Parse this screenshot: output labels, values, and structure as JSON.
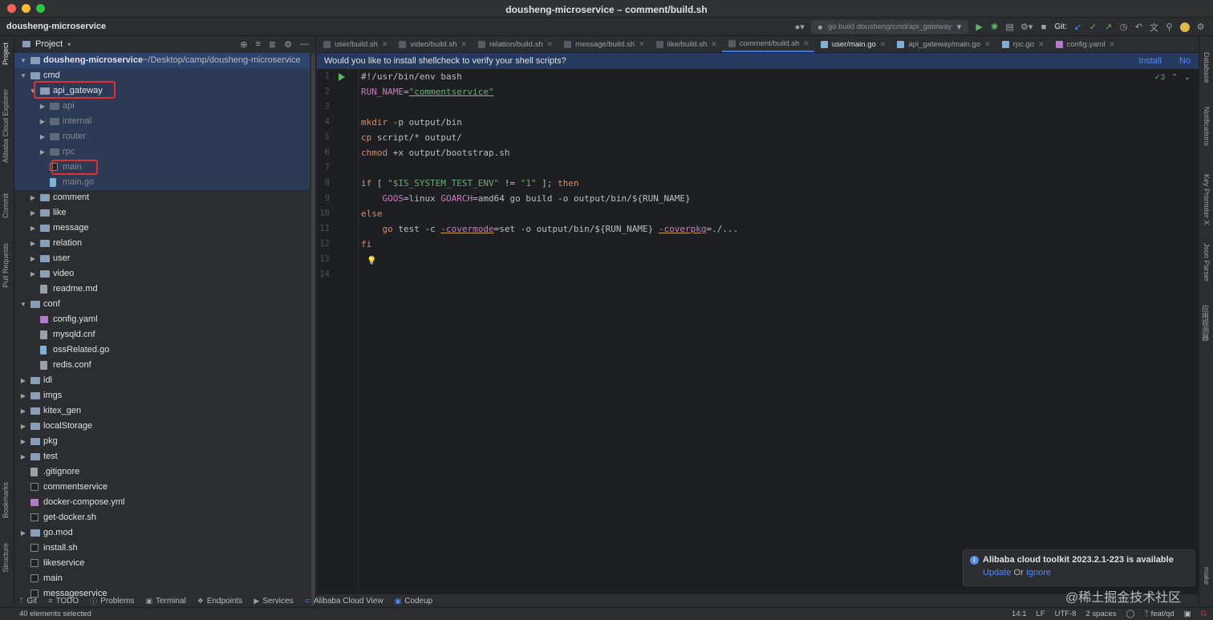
{
  "window": {
    "title": "dousheng-microservice – comment/build.sh",
    "traffic_lights": {
      "close": "#ff5f57",
      "minimize": "#febc2e",
      "maximize": "#28c840"
    }
  },
  "toolbar": {
    "project_name": "dousheng-microservice",
    "run_config": "go build dousheng/cmd/api_gateway",
    "git_label": "Git:"
  },
  "left_strip": [
    "Project",
    "Alibaba Cloud Explorer",
    "Commit",
    "Pull Requests",
    "Bookmarks",
    "Structure"
  ],
  "right_strip": [
    "Database",
    "Notifications",
    "Key Promoter X",
    "Json Parser",
    "应用观测器",
    "make"
  ],
  "project_panel": {
    "title": "Project",
    "root_name": "dousheng-microservice",
    "root_path": "~/Desktop/camp/dousheng-microservice",
    "tree": [
      {
        "label": "cmd",
        "depth": 1,
        "expanded": true,
        "type": "folder"
      },
      {
        "label": "api_gateway",
        "depth": 2,
        "expanded": true,
        "type": "folder",
        "highlight": true
      },
      {
        "label": "api",
        "depth": 3,
        "expanded": false,
        "type": "folder",
        "dim": true
      },
      {
        "label": "internal",
        "depth": 3,
        "expanded": false,
        "type": "folder",
        "dim": true
      },
      {
        "label": "router",
        "depth": 3,
        "expanded": false,
        "type": "folder",
        "dim": true
      },
      {
        "label": "rpc",
        "depth": 3,
        "expanded": false,
        "type": "folder",
        "dim": true
      },
      {
        "label": "main",
        "depth": 3,
        "type": "binary",
        "dim": true,
        "highlight": true
      },
      {
        "label": "main.go",
        "depth": 3,
        "type": "go",
        "dim": true
      },
      {
        "label": "comment",
        "depth": 2,
        "expanded": false,
        "type": "folder"
      },
      {
        "label": "like",
        "depth": 2,
        "expanded": false,
        "type": "folder"
      },
      {
        "label": "message",
        "depth": 2,
        "expanded": false,
        "type": "folder"
      },
      {
        "label": "relation",
        "depth": 2,
        "expanded": false,
        "type": "folder"
      },
      {
        "label": "user",
        "depth": 2,
        "expanded": false,
        "type": "folder"
      },
      {
        "label": "video",
        "depth": 2,
        "expanded": false,
        "type": "folder"
      },
      {
        "label": "readme.md",
        "depth": 2,
        "type": "md"
      },
      {
        "label": "conf",
        "depth": 1,
        "expanded": true,
        "type": "folder"
      },
      {
        "label": "config.yaml",
        "depth": 2,
        "type": "yml"
      },
      {
        "label": "mysqld.cnf",
        "depth": 2,
        "type": "txt"
      },
      {
        "label": "ossRelated.go",
        "depth": 2,
        "type": "go"
      },
      {
        "label": "redis.conf",
        "depth": 2,
        "type": "txt"
      },
      {
        "label": "idl",
        "depth": 1,
        "expanded": false,
        "type": "folder"
      },
      {
        "label": "imgs",
        "depth": 1,
        "expanded": false,
        "type": "folder"
      },
      {
        "label": "kitex_gen",
        "depth": 1,
        "expanded": false,
        "type": "folder"
      },
      {
        "label": "localStorage",
        "depth": 1,
        "expanded": false,
        "type": "folder"
      },
      {
        "label": "pkg",
        "depth": 1,
        "expanded": false,
        "type": "folder"
      },
      {
        "label": "test",
        "depth": 1,
        "expanded": false,
        "type": "folder"
      },
      {
        "label": ".gitignore",
        "depth": 1,
        "type": "txt"
      },
      {
        "label": "commentservice",
        "depth": 1,
        "type": "binary"
      },
      {
        "label": "docker-compose.yml",
        "depth": 1,
        "type": "yml"
      },
      {
        "label": "get-docker.sh",
        "depth": 1,
        "type": "sh"
      },
      {
        "label": "go.mod",
        "depth": 1,
        "expanded": false,
        "type": "folder"
      },
      {
        "label": "install.sh",
        "depth": 1,
        "type": "sh"
      },
      {
        "label": "likeservice",
        "depth": 1,
        "type": "binary"
      },
      {
        "label": "main",
        "depth": 1,
        "type": "binary"
      },
      {
        "label": "messageservice",
        "depth": 1,
        "type": "binary"
      }
    ]
  },
  "tabs": [
    {
      "label": "user/build.sh",
      "type": "sh"
    },
    {
      "label": "video/build.sh",
      "type": "sh"
    },
    {
      "label": "relation/build.sh",
      "type": "sh"
    },
    {
      "label": "message/build.sh",
      "type": "sh"
    },
    {
      "label": "like/build.sh",
      "type": "sh"
    },
    {
      "label": "comment/build.sh",
      "type": "sh",
      "active": true
    },
    {
      "label": "user/main.go",
      "type": "go",
      "bright": true
    },
    {
      "label": "api_gateway/main.go",
      "type": "go"
    },
    {
      "label": "rpc.go",
      "type": "go"
    },
    {
      "label": "config.yaml",
      "type": "yml"
    }
  ],
  "banner": {
    "text": "Would you like to install shellcheck to verify your shell scripts?",
    "install": "Install",
    "no": "No"
  },
  "editor": {
    "inspection_count": "3",
    "lines": [
      [
        [
          "t",
          "#!/usr/bin/env bash"
        ]
      ],
      [
        [
          "v",
          "RUN_NAME"
        ],
        [
          "t",
          "="
        ],
        [
          "s",
          "\"commentservice\""
        ]
      ],
      [],
      [
        [
          "k",
          "mkdir"
        ],
        [
          "t",
          " -p output/bin"
        ]
      ],
      [
        [
          "k",
          "cp"
        ],
        [
          "t",
          " script/* output/"
        ]
      ],
      [
        [
          "k",
          "chmod"
        ],
        [
          "t",
          " +x output/bootstrap.sh"
        ]
      ],
      [],
      [
        [
          "k",
          "if"
        ],
        [
          "t",
          " [ "
        ],
        [
          "s",
          "\"$IS_SYSTEM_TEST_ENV\""
        ],
        [
          "t",
          " != "
        ],
        [
          "s",
          "\"1\""
        ],
        [
          "t",
          " ]; "
        ],
        [
          "k",
          "then"
        ]
      ],
      [
        [
          "t",
          "    "
        ],
        [
          "v",
          "GOOS"
        ],
        [
          "t",
          "=linux "
        ],
        [
          "v",
          "GOARCH"
        ],
        [
          "t",
          "=amd64 go build -o output/bin/${RUN_NAME}"
        ]
      ],
      [
        [
          "k",
          "else"
        ]
      ],
      [
        [
          "t",
          "    "
        ],
        [
          "k",
          "go"
        ],
        [
          "t",
          " test -c "
        ],
        [
          "v",
          "-covermode"
        ],
        [
          "t",
          "=set -o output/bin/${RUN_NAME} "
        ],
        [
          "v",
          "-coverpkg"
        ],
        [
          "t",
          "=./..."
        ]
      ],
      [
        [
          "k",
          "fi"
        ]
      ],
      [],
      []
    ]
  },
  "tool_windows": [
    "Git",
    "TODO",
    "Problems",
    "Terminal",
    "Endpoints",
    "Services",
    "Alibaba Cloud View",
    "Codeup"
  ],
  "status_bar": {
    "left": "40 elements selected",
    "position": "14:1",
    "line_sep": "LF",
    "encoding": "UTF-8",
    "indent": "2 spaces",
    "branch": "feat/qd"
  },
  "notification": {
    "title": "Alibaba cloud toolkit 2023.2.1-223 is available",
    "update": "Update",
    "or": "Or",
    "ignore": "Ignore"
  },
  "watermark": "@稀土掘金技术社区"
}
